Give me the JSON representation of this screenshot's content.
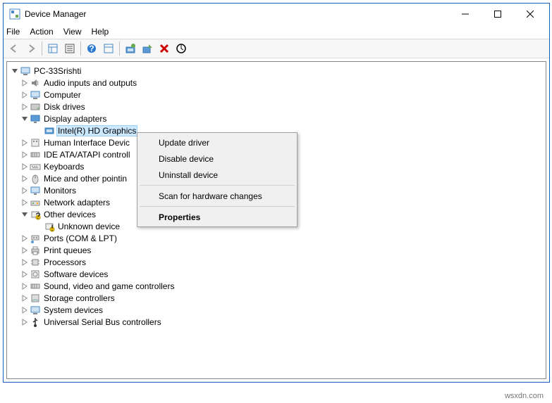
{
  "window": {
    "title": "Device Manager"
  },
  "menu": {
    "file": "File",
    "action": "Action",
    "view": "View",
    "help": "Help"
  },
  "tree": {
    "root": "PC-33Srishti",
    "items": [
      {
        "label": "Audio inputs and outputs",
        "expanded": false
      },
      {
        "label": "Computer",
        "expanded": false
      },
      {
        "label": "Disk drives",
        "expanded": false
      },
      {
        "label": "Display adapters",
        "expanded": true,
        "children": [
          {
            "label": "Intel(R) HD Graphics",
            "selected": true
          }
        ]
      },
      {
        "label": "Human Interface Devices",
        "truncated": "Human Interface Devic",
        "expanded": false
      },
      {
        "label": "IDE ATA/ATAPI controllers",
        "truncated": "IDE ATA/ATAPI controll",
        "expanded": false
      },
      {
        "label": "Keyboards",
        "expanded": false
      },
      {
        "label": "Mice and other pointing devices",
        "truncated": "Mice and other pointin",
        "expanded": false
      },
      {
        "label": "Monitors",
        "expanded": false
      },
      {
        "label": "Network adapters",
        "expanded": false
      },
      {
        "label": "Other devices",
        "expanded": true,
        "children": [
          {
            "label": "Unknown device"
          }
        ]
      },
      {
        "label": "Ports (COM & LPT)",
        "expanded": false
      },
      {
        "label": "Print queues",
        "expanded": false
      },
      {
        "label": "Processors",
        "expanded": false
      },
      {
        "label": "Software devices",
        "expanded": false
      },
      {
        "label": "Sound, video and game controllers",
        "expanded": false
      },
      {
        "label": "Storage controllers",
        "expanded": false
      },
      {
        "label": "System devices",
        "expanded": false
      },
      {
        "label": "Universal Serial Bus controllers",
        "expanded": false
      }
    ]
  },
  "context_menu": {
    "update": "Update driver",
    "disable": "Disable device",
    "uninstall": "Uninstall device",
    "scan": "Scan for hardware changes",
    "properties": "Properties"
  },
  "watermark": "wsxdn.com"
}
